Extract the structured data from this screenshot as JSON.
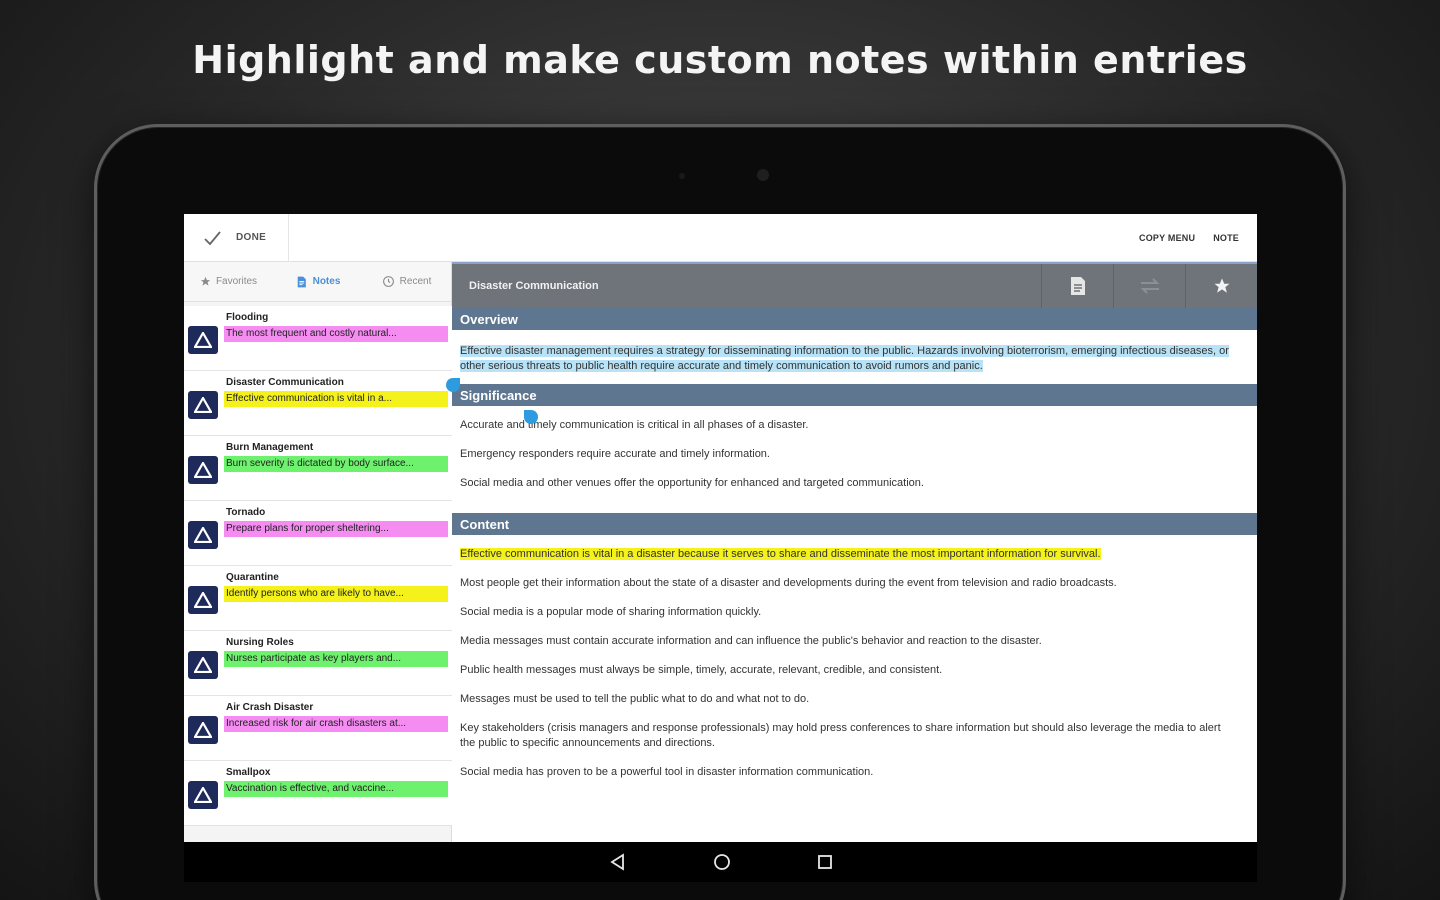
{
  "headline": "Highlight and make custom notes within entries",
  "actionbar": {
    "done_label": "DONE",
    "copy_menu_label": "COPY MENU",
    "note_label": "NOTE"
  },
  "tabs": [
    {
      "label": "Favorites",
      "icon": "star-icon"
    },
    {
      "label": "Notes",
      "icon": "notes-icon",
      "active": true
    },
    {
      "label": "Recent",
      "icon": "clock-icon"
    }
  ],
  "notes": [
    {
      "title": "Flooding",
      "note": "The most frequent and costly natural...",
      "color": "#f58cf2"
    },
    {
      "title": "Disaster Communication",
      "note": "Effective communication is vital in a...",
      "color": "#f4f21a"
    },
    {
      "title": "Burn Management",
      "note": "Burn severity is dictated by body surface...",
      "color": "#6ef26e"
    },
    {
      "title": "Tornado",
      "note": "Prepare plans for proper sheltering...",
      "color": "#f58cf2"
    },
    {
      "title": "Quarantine",
      "note": "Identify persons who are likely to have...",
      "color": "#f4f21a"
    },
    {
      "title": "Nursing Roles",
      "note": "Nurses participate as key players and...",
      "color": "#6ef26e"
    },
    {
      "title": "Air Crash Disaster",
      "note": "Increased risk for air crash disasters at...",
      "color": "#f58cf2"
    },
    {
      "title": "Smallpox",
      "note": "Vaccination is effective, and vaccine...",
      "color": "#6ef26e"
    }
  ],
  "detail": {
    "title": "Disaster Communication",
    "sections": {
      "overview": {
        "heading": "Overview",
        "text": "Effective disaster management requires a strategy for disseminating information to the public. Hazards involving bioterrorism, emerging infectious diseases, or other serious threats to public health require accurate and timely communication to avoid rumors and panic."
      },
      "significance": {
        "heading": "Significance",
        "paragraphs": [
          "Accurate and timely communication is critical in all phases of a disaster.",
          "Emergency responders require accurate and timely information.",
          "Social media and other venues offer the opportunity for enhanced and targeted communication."
        ]
      },
      "content": {
        "heading": "Content",
        "highlighted": "Effective communication is vital in a disaster because it serves to share and disseminate the most important information for survival.",
        "paragraphs": [
          "Most people get their information about the state of a disaster and developments during the event from television and radio broadcasts.",
          "Social media is a popular mode of sharing information quickly.",
          "Media messages must contain accurate information and can influence the public's behavior and reaction to the disaster.",
          "Public health messages must always be simple, timely, accurate, relevant, credible, and consistent.",
          "Messages must be used to tell the public what to do and what not to do.",
          "Key stakeholders (crisis managers and response professionals) may hold press conferences to share information but should also leverage the media to alert the public to specific announcements and directions.",
          "Social media has proven to be a powerful tool in disaster information communication."
        ]
      }
    }
  },
  "colors": {
    "accent": "#4a90d9",
    "section_bar": "#5f7690",
    "header_bar": "#6f737a",
    "badge": "#1e2a5a",
    "highlight_blue": "#b8e2f6",
    "highlight_yellow": "#f4f21a"
  }
}
